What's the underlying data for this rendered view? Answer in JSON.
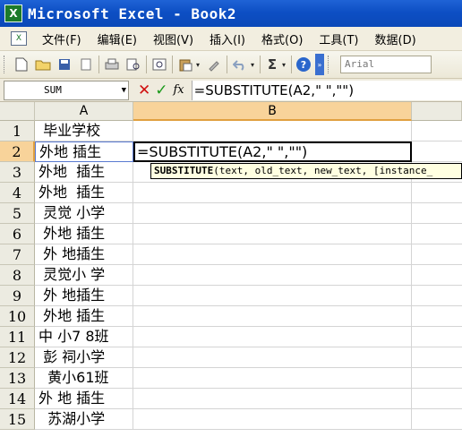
{
  "window": {
    "title": "Microsoft Excel - Book2",
    "icon": "excel-icon"
  },
  "menubar": {
    "items": [
      "文件(F)",
      "编辑(E)",
      "视图(V)",
      "插入(I)",
      "格式(O)",
      "工具(T)",
      "数据(D)"
    ]
  },
  "toolbar": {
    "font_name": "Arial",
    "sigma": "Σ",
    "help": "?"
  },
  "formula_bar": {
    "name_box": "SUM",
    "formula": "=SUBSTITUTE(A2,\" \",\"\")",
    "fx": "fx",
    "cancel": "✕",
    "enter": "✓"
  },
  "grid": {
    "columns": [
      "A",
      "B"
    ],
    "active_column": "B",
    "active_row": 2,
    "rows": [
      {
        "num": "1",
        "a": " 毕业学校"
      },
      {
        "num": "2",
        "a": "外地 插生"
      },
      {
        "num": "3",
        "a": "外地  插生"
      },
      {
        "num": "4",
        "a": "外地  插生"
      },
      {
        "num": "5",
        "a": " 灵觉 小学"
      },
      {
        "num": "6",
        "a": " 外地 插生"
      },
      {
        "num": "7",
        "a": " 外 地插生"
      },
      {
        "num": "8",
        "a": " 灵觉小 学"
      },
      {
        "num": "9",
        "a": " 外 地插生"
      },
      {
        "num": "10",
        "a": " 外地 插生"
      },
      {
        "num": "11",
        "a": "中 小7 8班"
      },
      {
        "num": "12",
        "a": " 彭 祠小学"
      },
      {
        "num": "13",
        "a": "  黄小61班"
      },
      {
        "num": "14",
        "a": "外 地 插生"
      },
      {
        "num": "15",
        "a": "  苏湖小学"
      }
    ],
    "editing_cell": {
      "ref": "B2",
      "content": "=SUBSTITUTE(A2,\" \",\"\")"
    },
    "tooltip": {
      "function_name": "SUBSTITUTE",
      "args": "(text, old_text, new_text, [instance_"
    }
  }
}
